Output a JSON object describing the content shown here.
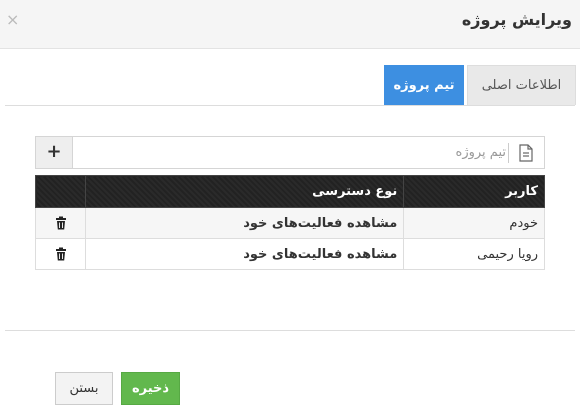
{
  "header": {
    "title": "ویرایش پروژه",
    "close_label": "×"
  },
  "tabs": [
    {
      "label": "اطلاعات اصلی",
      "active": false
    },
    {
      "label": "تیم پروژه",
      "active": true
    }
  ],
  "search": {
    "placeholder": "تیم پروژه",
    "value": "",
    "add_label": "+"
  },
  "table": {
    "columns": [
      "کاربر",
      "نوع دسترسی",
      ""
    ],
    "rows": [
      {
        "user": "خودم",
        "access": "مشاهده فعالیت‌های خود"
      },
      {
        "user": "رویا رحیمی",
        "access": "مشاهده فعالیت‌های خود"
      }
    ]
  },
  "footer": {
    "save_label": "ذخیره",
    "close_label": "بستن"
  },
  "colors": {
    "tab_active": "#3d8fe1",
    "save_button": "#62b84d",
    "table_header": "#222222"
  },
  "icons": {
    "close": "close-icon",
    "add": "plus-icon",
    "document": "document-icon",
    "delete": "trash-icon"
  }
}
